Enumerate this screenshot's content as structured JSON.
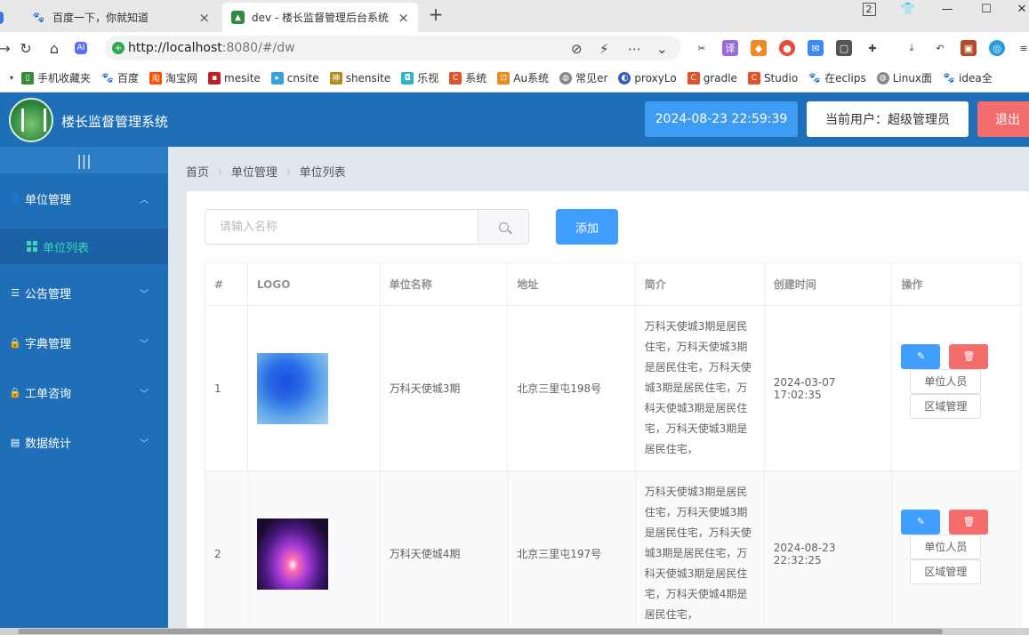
{
  "browser": {
    "tabs": [
      {
        "title": "百度一下，你就知道",
        "active": false
      },
      {
        "title": "dev - 楼长监督管理后台系统",
        "active": true
      }
    ],
    "new_tab_label": "+",
    "url_host": "http://localhost",
    "url_path": ":8080/#/dw",
    "bookmarks": [
      "手机收藏夹",
      "百度",
      "淘宝网",
      "mesite",
      "cnsite",
      "shensite",
      "乐视",
      "系统",
      "Au系统",
      "常见er",
      "proxyLo",
      "gradle",
      "Studio",
      "在eclips",
      "Linux面",
      "idea全"
    ]
  },
  "header": {
    "title": "楼长监督管理系统",
    "datetime": "2024-08-23 22:59:39",
    "current_user": "当前用户：超级管理员",
    "logout": "退出"
  },
  "sidebar": {
    "toggle": "|||",
    "items": [
      {
        "label": "单位管理",
        "icon": "user-icon",
        "expanded": true
      },
      {
        "label": "公告管理",
        "icon": "sliders-icon"
      },
      {
        "label": "字典管理",
        "icon": "lock-icon"
      },
      {
        "label": "工单咨询",
        "icon": "lock-icon"
      },
      {
        "label": "数据统计",
        "icon": "document-icon"
      }
    ],
    "sub_item": "单位列表"
  },
  "breadcrumb": [
    "首页",
    "单位管理",
    "单位列表"
  ],
  "toolbar": {
    "search_placeholder": "请输入名称",
    "add_label": "添加"
  },
  "table": {
    "columns": [
      "#",
      "LOGO",
      "单位名称",
      "地址",
      "简介",
      "创建时间",
      "操作"
    ],
    "rows": [
      {
        "index": "1",
        "name": "万科天使城3期",
        "address": "北京三里屯198号",
        "intro": "万科天使城3期是居民住宅，万科天使城3期是居民住宅，万科天使城3期是居民住宅，万科天使城3期是居民住宅，万科天使城3期是居民住宅，",
        "created": "2024-03-07 17:02:35"
      },
      {
        "index": "2",
        "name": "万科天使城4期",
        "address": "北京三里屯197号",
        "intro": "万科天使城3期是居民住宅，万科天使城3期是居民住宅，万科天使城3期是居民住宅，万科天使城3期是居民住宅，万科天使城4期是居民住宅，",
        "created": "2024-08-23 22:32:25"
      }
    ],
    "op_members": "单位人员",
    "op_areas": "区域管理"
  },
  "colors": {
    "primary": "#409eff",
    "danger": "#f56c6c",
    "sidebar": "#1e6fb8",
    "accent": "#3ed6b5"
  }
}
